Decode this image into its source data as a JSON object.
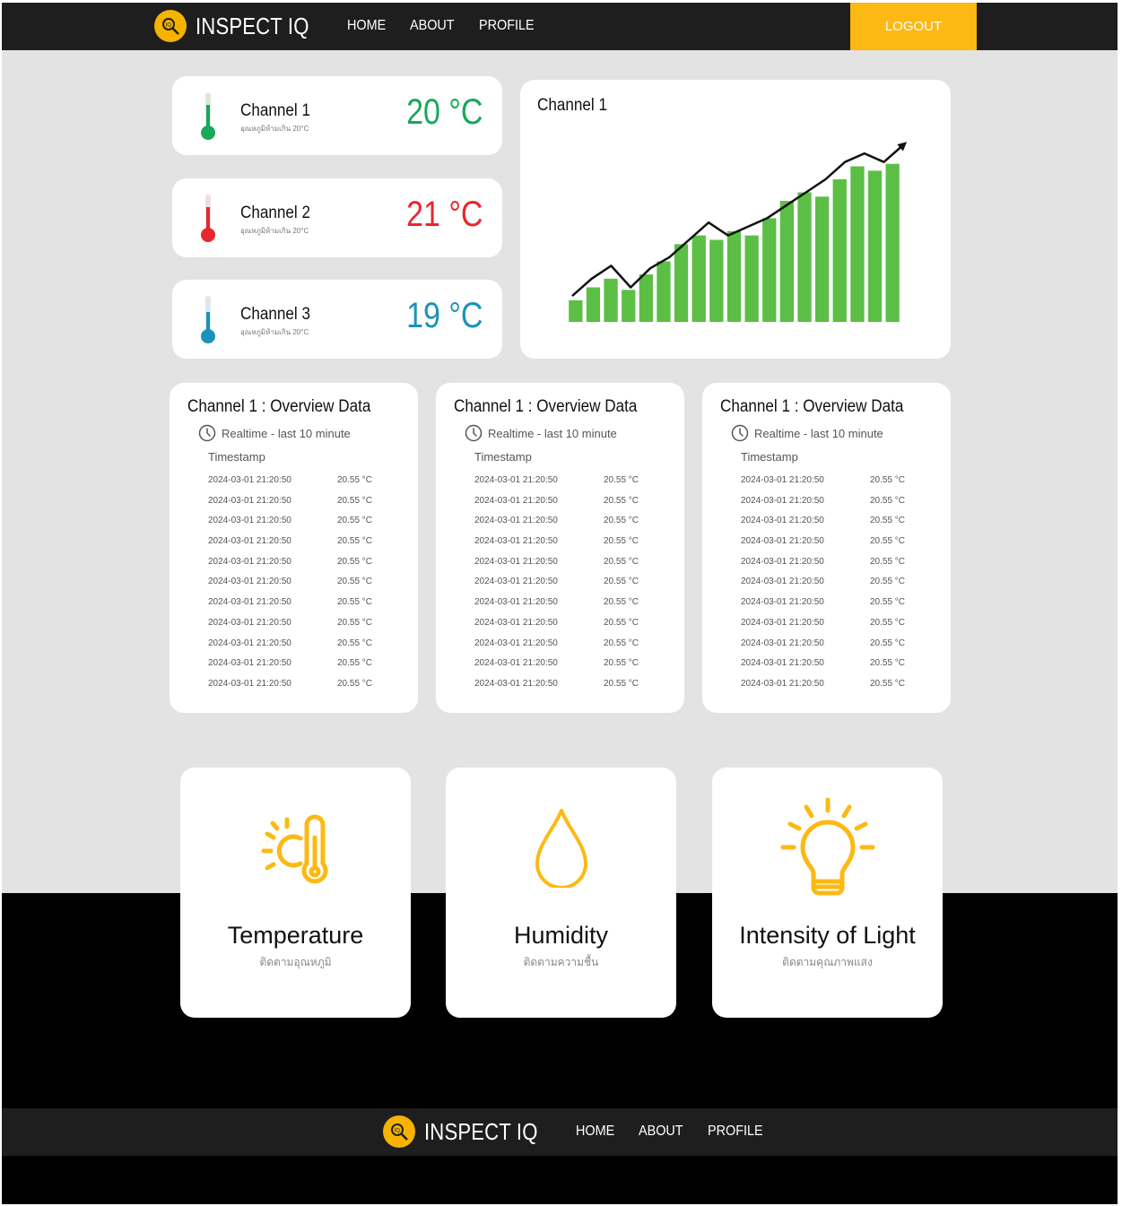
{
  "header": {
    "brand": "INSPECT IQ",
    "nav": [
      "HOME",
      "ABOUT",
      "PROFILE"
    ],
    "logout": "LOGOUT",
    "accent": "#fdb913"
  },
  "channels": [
    {
      "name": "Channel 1",
      "note": "อุณหภูมิห้ามเกิน 20°C",
      "value": "20 °C",
      "color": "#1aa75a"
    },
    {
      "name": "Channel 2",
      "note": "อุณหภูมิห้ามเกิน 20°C",
      "value": "21 °C",
      "color": "#e8262c"
    },
    {
      "name": "Channel 3",
      "note": "อุณหภูมิห้ามเกิน 20°C",
      "value": "19 °C",
      "color": "#1a93b8"
    }
  ],
  "chart": {
    "title": "Channel 1",
    "bar_color": "#5cbf45",
    "trend_color": "#111111"
  },
  "chart_data": {
    "type": "bar",
    "title": "Channel 1",
    "xlabel": "",
    "ylabel": "",
    "values": [
      2.5,
      4.0,
      5.0,
      3.7,
      5.5,
      7.0,
      9.0,
      10.0,
      9.5,
      10.5,
      10.0,
      12.0,
      14.0,
      15.0,
      14.5,
      16.5,
      18.0,
      17.5,
      18.3
    ],
    "trend": [
      3.0,
      5.0,
      6.5,
      4.0,
      6.2,
      7.5,
      9.5,
      11.5,
      10.0,
      11.0,
      12.0,
      13.5,
      15.0,
      16.5,
      18.5,
      19.5,
      18.5,
      20.5
    ],
    "ylim": [
      0,
      22
    ]
  },
  "overview": {
    "title": "Channel 1 : Overview  Data",
    "realtime": "Realtime - last 10 minute",
    "column": "Timestamp",
    "rows": [
      [
        "2024-03-01 21:20:50",
        "20.55 °C"
      ],
      [
        "2024-03-01 21:20:50",
        "20.55 °C"
      ],
      [
        "2024-03-01 21:20:50",
        "20.55 °C"
      ],
      [
        "2024-03-01 21:20:50",
        "20.55 °C"
      ],
      [
        "2024-03-01 21:20:50",
        "20.55 °C"
      ],
      [
        "2024-03-01 21:20:50",
        "20.55 °C"
      ],
      [
        "2024-03-01 21:20:50",
        "20.55 °C"
      ],
      [
        "2024-03-01 21:20:50",
        "20.55 °C"
      ],
      [
        "2024-03-01 21:20:50",
        "20.55 °C"
      ],
      [
        "2024-03-01 21:20:50",
        "20.55 °C"
      ],
      [
        "2024-03-01 21:20:50",
        "20.55 °C"
      ]
    ]
  },
  "features": [
    {
      "title": "Temperature",
      "sub": "ติดตามอุณหภูมิ",
      "icon": "sun-thermometer-icon"
    },
    {
      "title": "Humidity",
      "sub": "ติดตามความชื้น",
      "icon": "water-drop-icon"
    },
    {
      "title": "Intensity of Light",
      "sub": "ติดตามคุณภาพแสง",
      "icon": "light-bulb-icon"
    }
  ],
  "footer": {
    "brand": "INSPECT IQ",
    "nav": [
      "HOME",
      "ABOUT",
      "PROFILE"
    ]
  }
}
